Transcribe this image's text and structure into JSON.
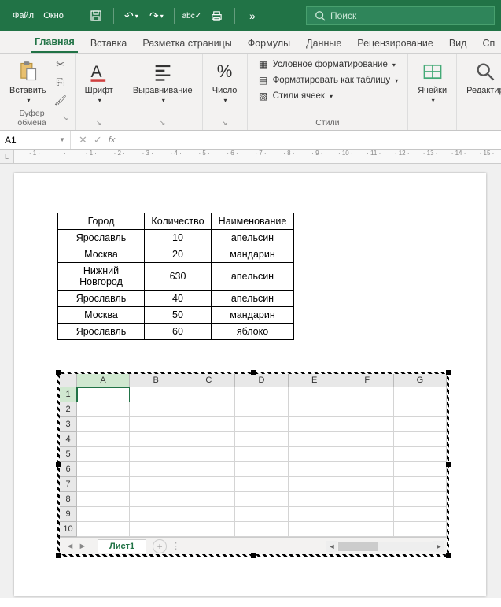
{
  "titlebar": {
    "menu_label": "Файл    Окно"
  },
  "search": {
    "placeholder": "Поиск"
  },
  "tabs": [
    "Главная",
    "Вставка",
    "Разметка страницы",
    "Формулы",
    "Данные",
    "Рецензирование",
    "Вид",
    "Сп"
  ],
  "active_tab": 0,
  "ribbon": {
    "clipboard": {
      "paste": "Вставить",
      "label": "Буфер обмена"
    },
    "font": {
      "btn": "Шрифт",
      "label": "Шрифт"
    },
    "alignment": {
      "btn": "Выравнивание",
      "label": "Выравнивание"
    },
    "number": {
      "btn": "Число",
      "label": "Число"
    },
    "styles": {
      "cond_format": "Условное форматирование",
      "as_table": "Форматировать как таблицу",
      "cell_styles": "Стили ячеек",
      "label": "Стили"
    },
    "cells": {
      "btn": "Ячейки",
      "label": "Ячейки"
    },
    "editing": {
      "btn": "Редактир"
    }
  },
  "formula_bar": {
    "name_box": "A1",
    "fx": "fx"
  },
  "ruler_ticks": [
    "1",
    "",
    "1",
    "2",
    "3",
    "4",
    "5",
    "6",
    "7",
    "8",
    "9",
    "10",
    "11",
    "12",
    "13",
    "14",
    "15"
  ],
  "data_table": {
    "headers": [
      "Город",
      "Количество",
      "Наименование"
    ],
    "rows": [
      [
        "Ярославль",
        "10",
        "апельсин"
      ],
      [
        "Москва",
        "20",
        "мандарин"
      ],
      [
        "Нижний Новгород",
        "630",
        "апельсин"
      ],
      [
        "Ярославль",
        "40",
        "апельсин"
      ],
      [
        "Москва",
        "50",
        "мандарин"
      ],
      [
        "Ярославль",
        "60",
        "яблоко"
      ]
    ]
  },
  "sheet": {
    "col_headers": [
      "A",
      "B",
      "C",
      "D",
      "E",
      "F",
      "G"
    ],
    "row_headers": [
      "1",
      "2",
      "3",
      "4",
      "5",
      "6",
      "7",
      "8",
      "9",
      "10"
    ],
    "selected": "A1",
    "tab_name": "Лист1"
  }
}
